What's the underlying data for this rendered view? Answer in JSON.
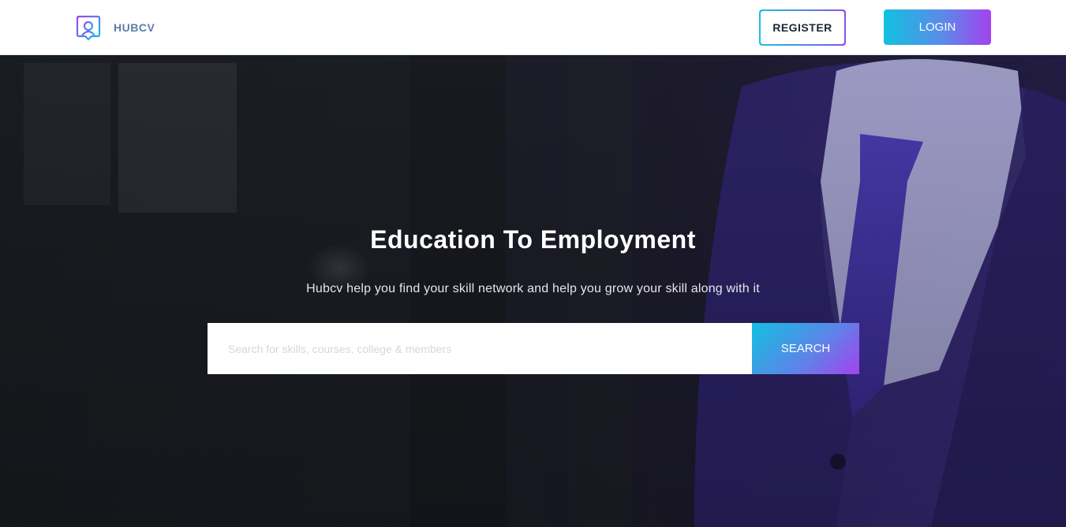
{
  "header": {
    "brand_name": "HUBCV",
    "logo_icon": "hubcv-logo-icon",
    "register_label": "REGISTER",
    "login_label": "LOGIN"
  },
  "hero": {
    "title": "Education To Employment",
    "subtitle": "Hubcv help you find your skill network and help you grow your skill along with it",
    "search": {
      "placeholder": "Search for skills, courses, college & members",
      "value": "",
      "button_label": "SEARCH"
    }
  },
  "colors": {
    "accent_start": "#12c0e0",
    "accent_end": "#a342ee",
    "brand_text": "#5a7da8"
  }
}
